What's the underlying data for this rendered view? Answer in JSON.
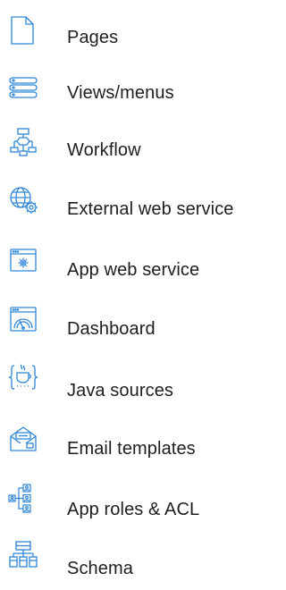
{
  "menu": {
    "accent_color": "#2f86d6",
    "items": [
      {
        "label": "Pages",
        "icon": "pages-icon"
      },
      {
        "label": "Views/menus",
        "icon": "views-menus-icon"
      },
      {
        "label": "Workflow",
        "icon": "workflow-icon"
      },
      {
        "label": "External web service",
        "icon": "external-web-service-icon"
      },
      {
        "label": "App web service",
        "icon": "app-web-service-icon"
      },
      {
        "label": "Dashboard",
        "icon": "dashboard-icon"
      },
      {
        "label": "Java sources",
        "icon": "java-sources-icon"
      },
      {
        "label": "Email templates",
        "icon": "email-templates-icon"
      },
      {
        "label": "App roles & ACL",
        "icon": "app-roles-acl-icon"
      },
      {
        "label": "Schema",
        "icon": "schema-icon"
      }
    ]
  }
}
